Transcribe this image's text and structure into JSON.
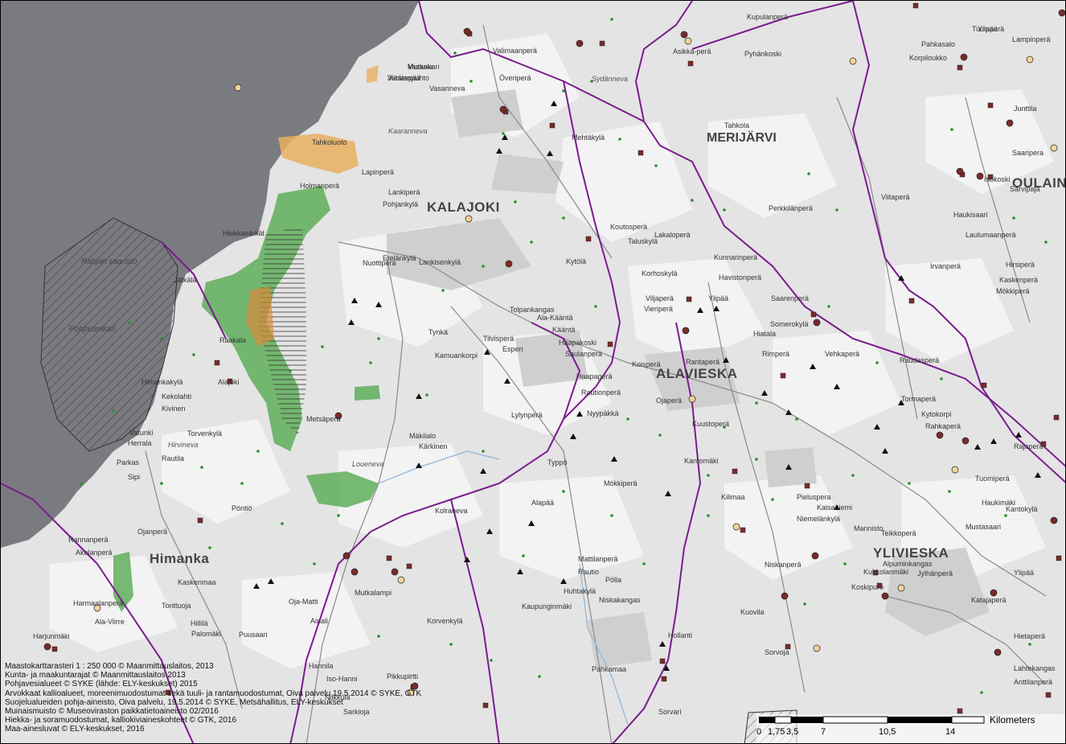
{
  "map": {
    "colors": {
      "sea": "#7a7b80",
      "land": "#e4e4e4",
      "field": "#f4f4f4",
      "forest": "#d2d2d2",
      "groundwater": "#5fae5a",
      "boundary": "#7b1c8e",
      "road": "#8a8a8a",
      "sand": "#e8b060",
      "redpoint": "#7b2a2a"
    },
    "towns": [
      {
        "name": "KALAJOKI"
      },
      {
        "name": "MERIJÄRVI"
      },
      {
        "name": "ALAVIESKA"
      },
      {
        "name": "YLIVIESKA"
      },
      {
        "name": "Himanka"
      },
      {
        "name": "OULAIN"
      }
    ],
    "places": [
      "Vasankari",
      "Juolaspää",
      "Vasanneva",
      "Valimaanperä",
      "Överiperä",
      "Asikka-perä",
      "Kupulanperä",
      "Tuulaperä",
      "Lampinperä",
      "Pahkasalo",
      "Korpiloukko",
      "Pyhänkoski",
      "Lapinperä",
      "Tahkoluoto",
      "Holmanperä",
      "Hiekkasärkät",
      "Lankiperä",
      "Pohjankylä",
      "Nuottiperä",
      "Etelänkylä",
      "Lankisenkylä",
      "Jätkälä",
      "Raakala",
      "Himankakylä",
      "Alajoki",
      "Kekolahti",
      "Kivinen",
      "Vatunki",
      "Herrala",
      "Torvenkylä",
      "Rautila",
      "Parkas",
      "Sipi",
      "Pöntiö",
      "Rannanperä",
      "Ojanperä",
      "Akolanperä",
      "Kaskenmaa",
      "Tonttuoja",
      "Hillilä",
      "Palomäki",
      "Harmaalanperä",
      "Ala-Viirre",
      "Harjunmäki",
      "Puusaari",
      "Oja-Matti",
      "Ainali",
      "Mutkalampi",
      "Korvenkylä",
      "Hannila",
      "Iso-Hanni",
      "Nilkkula",
      "Pikkupirtti",
      "Sarkioja",
      "Mehtäkylä",
      "Tahkola",
      "Perkkilänperä",
      "Koutosperä",
      "Taluskylä",
      "Lakaloperä",
      "Kytölä",
      "Tolpankangas",
      "Ala-Kääntä",
      "Kääntä",
      "Tynkä",
      "Tilvisperä",
      "Esperi",
      "Kamuankorpi",
      "Haapakoski",
      "Saulanperä",
      "Haapaperä",
      "Rautionperä",
      "Nyypäkkä",
      "Lylynperä",
      "Metsäperä",
      "Mäkilalo",
      "Kärkinen",
      "Typpö",
      "Alapää",
      "Kolraneva",
      "Mökkiperä",
      "Mattilanperä",
      "Rautio",
      "Pölla",
      "Huhtakylä",
      "Niskakangas",
      "Kaupunginmäki",
      "Pahkamaa",
      "Hollanti",
      "Sorvari",
      "Korhoskylä",
      "Ylipää",
      "Kunnarinperä",
      "Havistonperä",
      "Saarenperä",
      "Viljaperä",
      "Vieriperä",
      "Hiatala",
      "Somerokylä",
      "Rimperä",
      "Vehkaperä",
      "Rantaperä",
      "Koisperä",
      "Ojaperä",
      "Kuustoperä",
      "Kantomäki",
      "Kilimaa",
      "Pieluspera",
      "Niemelänkylä",
      "Kaisaniemi",
      "Mannisto",
      "Alpuminkangas",
      "Kukkolanmäki",
      "Koskipuro",
      "Katajaperä",
      "Sorvoja",
      "Kuovila",
      "Niskanperä",
      "Ylipää",
      "Kantokylä",
      "Tuomiperä",
      "Rajaperä",
      "Viitaperä",
      "Haukisaari",
      "Laulumaanperä",
      "Irvanperä",
      "Hirsiperä",
      "Kaskenperä",
      "Mökkiperä",
      "Raudasperä",
      "Tormaperä",
      "Kytokorpi",
      "Rahkaperä",
      "Haukimäki",
      "Teikkoperä",
      "Mustasaari",
      "Hietaperä",
      "Lahtekangas",
      "Anttilanperä",
      "Jylhänperä",
      "Isokoski",
      "Ylipää",
      "Sarvipaja",
      "Junttila",
      "Saaripera",
      "Mutkala",
      "Viitalanpuhto"
    ],
    "waters": [
      "Rahjan saaristo",
      "Pohjasenkari",
      "Seljan",
      "Loueneva",
      "Sydänneva",
      "Koksenneva",
      "Kaaranneva",
      "Hirvineva"
    ],
    "credits": [
      "Maastokarttarasteri 1 : 250 000 © Maanmittauslaitos, 2013",
      "Kunta- ja maakuntarajat © Maanmittauslaitos 2013",
      "Pohjavesialueet © SYKE (lähde: ELY-keskukset) 2015",
      "Arvokkaat kallioalueet, moreenimuodostumat sekä tuuli- ja rantamuodostumat, Oiva palvelu 19.5.2014 © SYKE, GTK",
      "Suojelualueiden pohja-aineisto, Oiva palvelu, 19.5.2014 © SYKE, Metsähallitus, ELY-keskukset",
      "Muinaismuisto © Museoviraston paikkatietoaineisto 02/2016",
      "Hiekka- ja soramuodostumat, kalliokiviaineskohteet © GTK, 2016",
      "Maa-ainesluvat © ELY-keskukset, 2016"
    ],
    "scale": {
      "unit": "Kilometers",
      "ticks": [
        "0",
        "1,75",
        "3,5",
        "7",
        "10,5",
        "14"
      ]
    }
  }
}
